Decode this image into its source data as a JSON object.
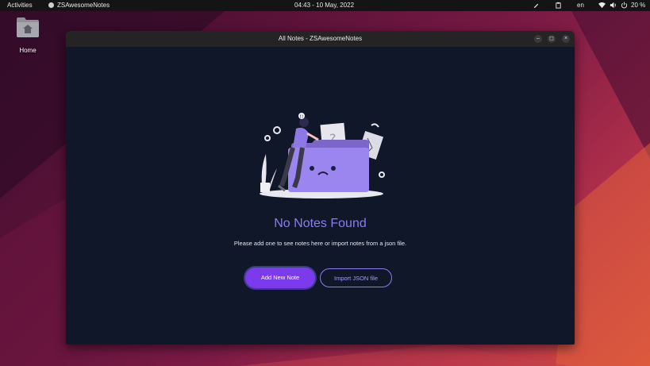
{
  "topbar": {
    "activities": "Activities",
    "app_name": "ZSAwesomeNotes",
    "clock": "04:43 - 10 May, 2022",
    "language": "en",
    "battery": "20 %"
  },
  "desktop": {
    "home_label": "Home"
  },
  "window": {
    "title": "All Notes - ZSAwesomeNotes",
    "minimize_glyph": "–",
    "maximize_glyph": "◻",
    "close_glyph": "×"
  },
  "empty_state": {
    "title": "No Notes Found",
    "subtitle": "Please add one to see notes here or import notes from a json file.",
    "add_button": "Add New Note",
    "import_button": "Import JSON file"
  },
  "colors": {
    "accent": "#7c3aed",
    "accent_text": "#8b7cf0",
    "window_bg": "#0f1729"
  }
}
